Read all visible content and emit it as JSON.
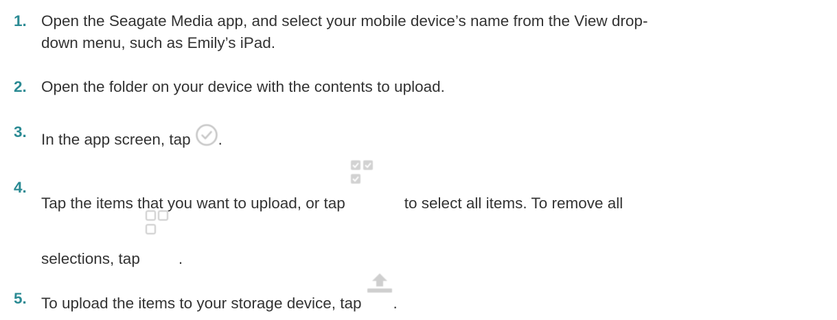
{
  "steps": [
    {
      "number": "1.",
      "line1": "Open the Seagate Media app, and select your mobile device’s name from the View drop-",
      "line2": "down menu, such as Emily’s iPad."
    },
    {
      "number": "2.",
      "text": "Open the folder on your device with the contents to upload."
    },
    {
      "number": "3.",
      "before_icon": "In the app screen, tap",
      "after_icon": ".",
      "icon": "check-circle-icon"
    },
    {
      "number": "4.",
      "before_icon": "Tap the items that you want to upload, or tap",
      "after_icon": "to select all items. To remove all",
      "icon": "select-all-icon",
      "line2_before_icon": "selections, tap",
      "line2_after_icon": ".",
      "icon2": "deselect-all-icon"
    },
    {
      "number": "5.",
      "before_icon": "To upload the items to your storage device, tap",
      "after_icon": ".",
      "icon": "upload-icon"
    }
  ],
  "colors": {
    "number": "#2a8a93",
    "text": "#333333",
    "icon": "#c8c8c8"
  }
}
